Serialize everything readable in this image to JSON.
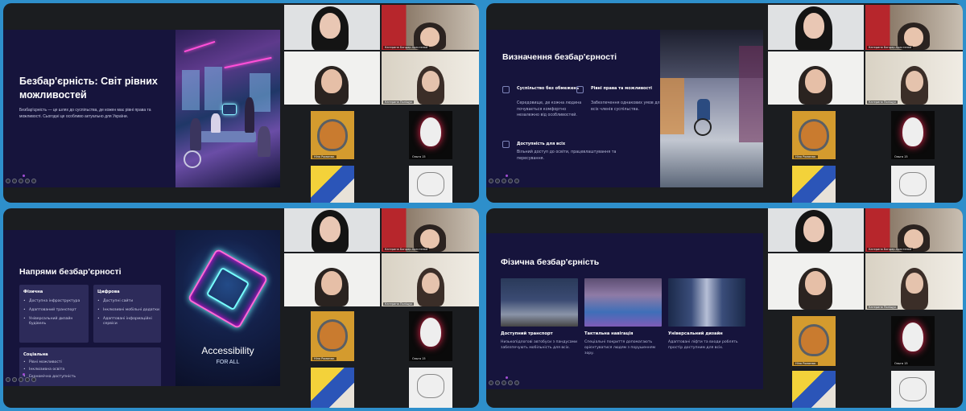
{
  "quadrants": [
    {
      "slide": {
        "title": "Безбар'єрність: Світ рівних можливостей",
        "body": "Безбар'єрність — це шлях до суспільства, де кожен має рівні права та можливості. Сьогодні це особливо актуально для України."
      }
    },
    {
      "slide": {
        "title": "Визначення безбар'єрності",
        "features": [
          {
            "title": "Суспільство без обмежень",
            "desc": "Середовище, де кожна людина почувається комфортно незалежно від особливостей.",
            "icon": "people-icon"
          },
          {
            "title": "Рівні права та можливості",
            "desc": "Забезпечення однакових умов для всіх членів суспільства.",
            "icon": "balance-icon"
          },
          {
            "title": "Доступність для всіх",
            "desc": "Вільний доступ до освіти, працевлаштування та пересування.",
            "icon": "door-icon"
          }
        ]
      }
    },
    {
      "slide": {
        "title": "Напрями безбар'єрності",
        "cards": [
          {
            "title": "Фізична",
            "items": [
              "Доступна інфраструктура",
              "Адаптований транспорт",
              "Універсальний дизайн будівель"
            ]
          },
          {
            "title": "Цифрова",
            "items": [
              "Доступні сайти",
              "Інклюзивні мобільні додатки",
              "Адаптовані інформаційні сервіси"
            ]
          },
          {
            "title": "Соціальна",
            "items": [
              "Рівні можливості",
              "Інклюзивна освіта",
              "Економічна доступність"
            ]
          }
        ],
        "image_text": {
          "main": "Accessibility",
          "sub": "FOR ALL"
        }
      }
    },
    {
      "slide": {
        "title": "Фізична безбар'єрність",
        "columns": [
          {
            "title": "Доступний транспорт",
            "desc": "Низькопідлогові автобуси з пандусами забезпечують мобільність для всіх."
          },
          {
            "title": "Тактильна навігація",
            "desc": "Спеціальні покриття допомагають орієнтуватися людям з порушенням зору."
          },
          {
            "title": "Універсальний дизайн",
            "desc": "Адаптовані ліфти та входи роблять простір доступним для всіх."
          }
        ]
      }
    }
  ],
  "participants": {
    "tile1": "",
    "tile2": "Катерина Бондар-Хрестенко",
    "tile3": "",
    "tile4": "Катерина Поліщук",
    "tile5": "Ніна Романюк",
    "tile6": "Ольга 15",
    "tile7": "",
    "tile8": ""
  },
  "colors": {
    "background": "#2e8fcb",
    "panel": "#1b1d20",
    "slide": "#16143c",
    "card": "#2d2b5a",
    "accent": "#a44fd6"
  }
}
